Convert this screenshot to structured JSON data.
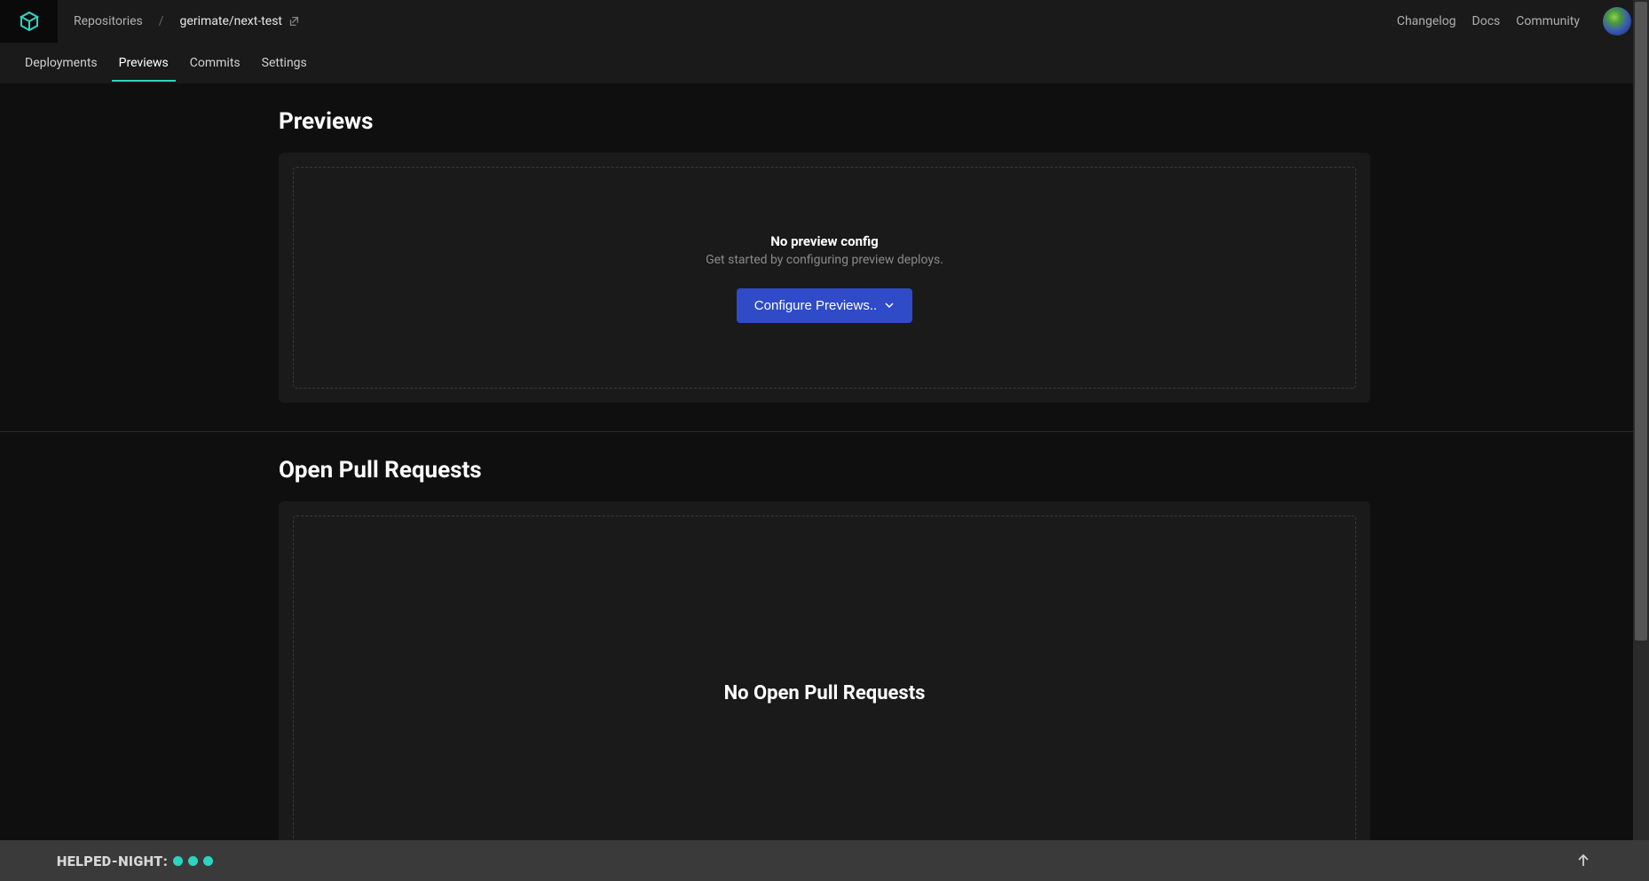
{
  "breadcrumb": {
    "root": "Repositories",
    "separator": "/",
    "current": "gerimate/next-test"
  },
  "topnav": {
    "changelog": "Changelog",
    "docs": "Docs",
    "community": "Community"
  },
  "tabs": {
    "deployments": "Deployments",
    "previews": "Previews",
    "commits": "Commits",
    "settings": "Settings"
  },
  "previews_section": {
    "title": "Previews",
    "empty_title": "No preview config",
    "empty_subtitle": "Get started by configuring preview deploys.",
    "button_label": "Configure Previews.."
  },
  "prs_section": {
    "title": "Open Pull Requests",
    "empty_title": "No Open Pull Requests"
  },
  "footer": {
    "label": "HELPED-NIGHT:"
  }
}
